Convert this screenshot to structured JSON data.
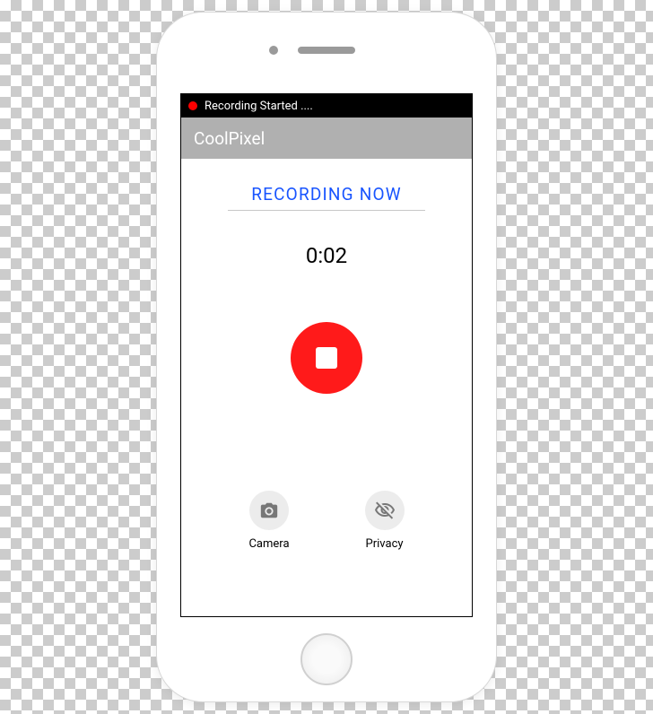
{
  "notification": {
    "text": "Recording Started ...."
  },
  "header": {
    "title": "CoolPixel"
  },
  "status": {
    "label": "RECORDING NOW",
    "timer": "0:02"
  },
  "actions": {
    "camera": {
      "label": "Camera"
    },
    "privacy": {
      "label": "Privacy"
    }
  },
  "colors": {
    "accent_record": "#ff1a1a",
    "status_text": "#1854ff",
    "header_bg": "#b0b0b0"
  }
}
